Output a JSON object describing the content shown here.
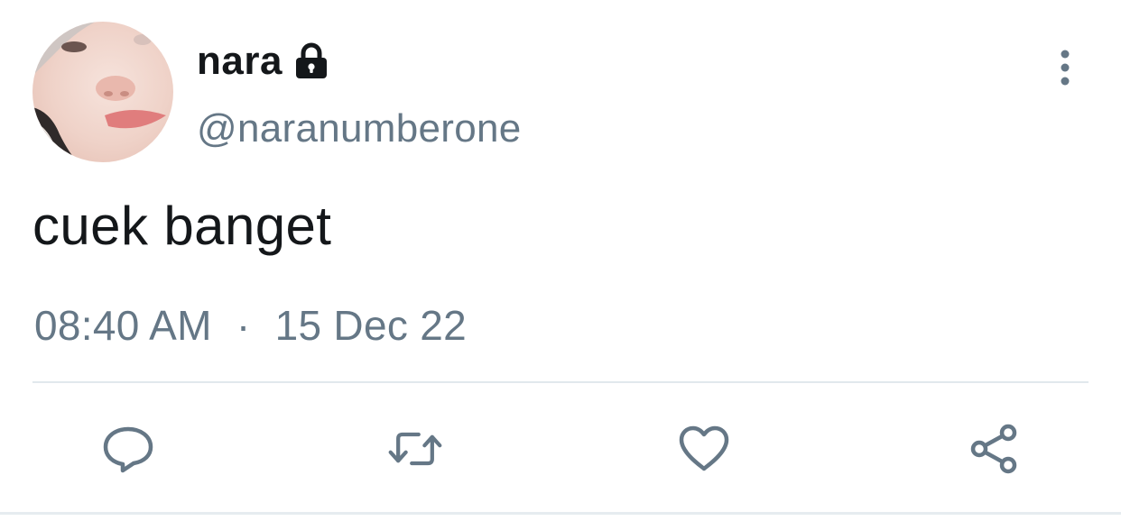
{
  "tweet": {
    "display_name": "nara",
    "handle": "@naranumberone",
    "text": "cuek banget",
    "time": "08:40 AM",
    "separator": "·",
    "date": "15 Dec 22",
    "protected_icon": "lock-icon",
    "avatar_icon": "avatar-photo"
  },
  "actions": [
    {
      "name": "reply",
      "icon": "speech-bubble-icon"
    },
    {
      "name": "retweet",
      "icon": "retweet-icon"
    },
    {
      "name": "like",
      "icon": "heart-icon"
    },
    {
      "name": "share",
      "icon": "share-icon"
    }
  ],
  "menu": {
    "icon": "vertical-ellipsis-icon"
  },
  "colors": {
    "text_primary": "#14171a",
    "text_secondary": "#657786",
    "divider": "#e1e8ed",
    "background": "#ffffff"
  }
}
